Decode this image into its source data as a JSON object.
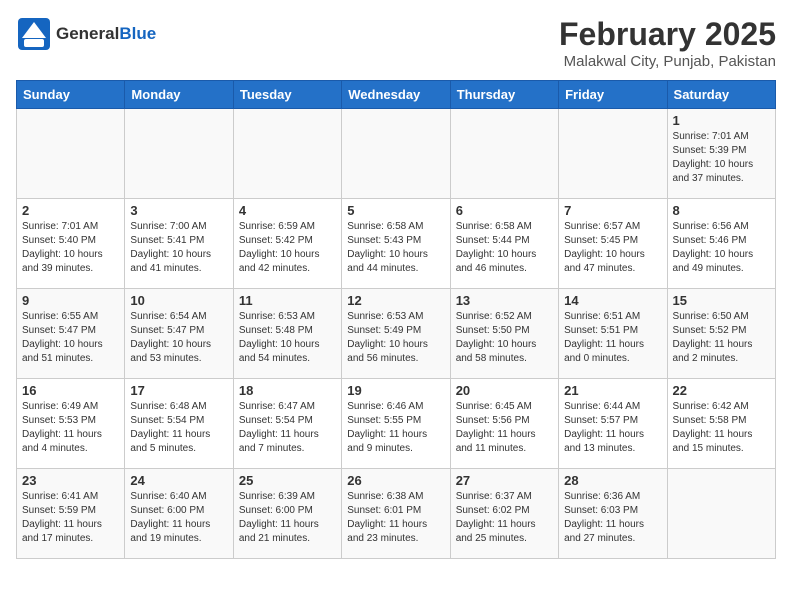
{
  "header": {
    "logo_general": "General",
    "logo_blue": "Blue",
    "title": "February 2025",
    "subtitle": "Malakwal City, Punjab, Pakistan"
  },
  "weekdays": [
    "Sunday",
    "Monday",
    "Tuesday",
    "Wednesday",
    "Thursday",
    "Friday",
    "Saturday"
  ],
  "weeks": [
    [
      {
        "day": "",
        "info": ""
      },
      {
        "day": "",
        "info": ""
      },
      {
        "day": "",
        "info": ""
      },
      {
        "day": "",
        "info": ""
      },
      {
        "day": "",
        "info": ""
      },
      {
        "day": "",
        "info": ""
      },
      {
        "day": "1",
        "info": "Sunrise: 7:01 AM\nSunset: 5:39 PM\nDaylight: 10 hours\nand 37 minutes."
      }
    ],
    [
      {
        "day": "2",
        "info": "Sunrise: 7:01 AM\nSunset: 5:40 PM\nDaylight: 10 hours\nand 39 minutes."
      },
      {
        "day": "3",
        "info": "Sunrise: 7:00 AM\nSunset: 5:41 PM\nDaylight: 10 hours\nand 41 minutes."
      },
      {
        "day": "4",
        "info": "Sunrise: 6:59 AM\nSunset: 5:42 PM\nDaylight: 10 hours\nand 42 minutes."
      },
      {
        "day": "5",
        "info": "Sunrise: 6:58 AM\nSunset: 5:43 PM\nDaylight: 10 hours\nand 44 minutes."
      },
      {
        "day": "6",
        "info": "Sunrise: 6:58 AM\nSunset: 5:44 PM\nDaylight: 10 hours\nand 46 minutes."
      },
      {
        "day": "7",
        "info": "Sunrise: 6:57 AM\nSunset: 5:45 PM\nDaylight: 10 hours\nand 47 minutes."
      },
      {
        "day": "8",
        "info": "Sunrise: 6:56 AM\nSunset: 5:46 PM\nDaylight: 10 hours\nand 49 minutes."
      }
    ],
    [
      {
        "day": "9",
        "info": "Sunrise: 6:55 AM\nSunset: 5:47 PM\nDaylight: 10 hours\nand 51 minutes."
      },
      {
        "day": "10",
        "info": "Sunrise: 6:54 AM\nSunset: 5:47 PM\nDaylight: 10 hours\nand 53 minutes."
      },
      {
        "day": "11",
        "info": "Sunrise: 6:53 AM\nSunset: 5:48 PM\nDaylight: 10 hours\nand 54 minutes."
      },
      {
        "day": "12",
        "info": "Sunrise: 6:53 AM\nSunset: 5:49 PM\nDaylight: 10 hours\nand 56 minutes."
      },
      {
        "day": "13",
        "info": "Sunrise: 6:52 AM\nSunset: 5:50 PM\nDaylight: 10 hours\nand 58 minutes."
      },
      {
        "day": "14",
        "info": "Sunrise: 6:51 AM\nSunset: 5:51 PM\nDaylight: 11 hours\nand 0 minutes."
      },
      {
        "day": "15",
        "info": "Sunrise: 6:50 AM\nSunset: 5:52 PM\nDaylight: 11 hours\nand 2 minutes."
      }
    ],
    [
      {
        "day": "16",
        "info": "Sunrise: 6:49 AM\nSunset: 5:53 PM\nDaylight: 11 hours\nand 4 minutes."
      },
      {
        "day": "17",
        "info": "Sunrise: 6:48 AM\nSunset: 5:54 PM\nDaylight: 11 hours\nand 5 minutes."
      },
      {
        "day": "18",
        "info": "Sunrise: 6:47 AM\nSunset: 5:54 PM\nDaylight: 11 hours\nand 7 minutes."
      },
      {
        "day": "19",
        "info": "Sunrise: 6:46 AM\nSunset: 5:55 PM\nDaylight: 11 hours\nand 9 minutes."
      },
      {
        "day": "20",
        "info": "Sunrise: 6:45 AM\nSunset: 5:56 PM\nDaylight: 11 hours\nand 11 minutes."
      },
      {
        "day": "21",
        "info": "Sunrise: 6:44 AM\nSunset: 5:57 PM\nDaylight: 11 hours\nand 13 minutes."
      },
      {
        "day": "22",
        "info": "Sunrise: 6:42 AM\nSunset: 5:58 PM\nDaylight: 11 hours\nand 15 minutes."
      }
    ],
    [
      {
        "day": "23",
        "info": "Sunrise: 6:41 AM\nSunset: 5:59 PM\nDaylight: 11 hours\nand 17 minutes."
      },
      {
        "day": "24",
        "info": "Sunrise: 6:40 AM\nSunset: 6:00 PM\nDaylight: 11 hours\nand 19 minutes."
      },
      {
        "day": "25",
        "info": "Sunrise: 6:39 AM\nSunset: 6:00 PM\nDaylight: 11 hours\nand 21 minutes."
      },
      {
        "day": "26",
        "info": "Sunrise: 6:38 AM\nSunset: 6:01 PM\nDaylight: 11 hours\nand 23 minutes."
      },
      {
        "day": "27",
        "info": "Sunrise: 6:37 AM\nSunset: 6:02 PM\nDaylight: 11 hours\nand 25 minutes."
      },
      {
        "day": "28",
        "info": "Sunrise: 6:36 AM\nSunset: 6:03 PM\nDaylight: 11 hours\nand 27 minutes."
      },
      {
        "day": "",
        "info": ""
      }
    ]
  ]
}
